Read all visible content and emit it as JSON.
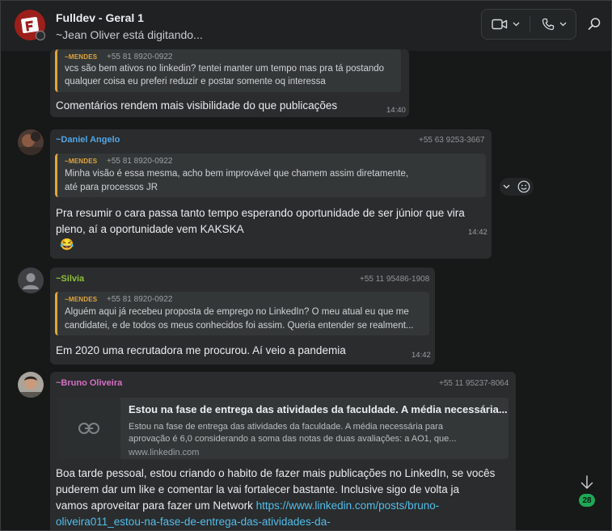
{
  "header": {
    "title": "Fulldev - Geral 1",
    "subtitle": "~Jean Oliver está digitando..."
  },
  "messages": [
    {
      "quote": {
        "name": "~MENDES",
        "phone": "+55 81 8920-0922",
        "lines": [
          "vcs são bem ativos no linkedin? tentei manter um tempo mas pra tá postando",
          "qualquer coisa eu preferi reduzir e postar somente oq interessa"
        ]
      },
      "text": [
        "Comentários rendem mais visibilidade do que publicações"
      ],
      "time": "14:40"
    },
    {
      "sender": "~Daniel Angelo",
      "sender_color": "#53a6e6",
      "phone": "+55 63 9253-3667",
      "quote": {
        "name": "~MENDES",
        "phone": "+55 81 8920-0922",
        "lines": [
          "Minha visão é essa mesma, acho bem improvável que chamem assim diretamente,",
          "até para processos JR"
        ]
      },
      "text": [
        "Pra resumir o cara passa tanto tempo esperando oportunidade de ser júnior que vira",
        "pleno, aí a oportunidade vem KAKSKA"
      ],
      "emoji": "😂",
      "time": "14:42"
    },
    {
      "sender": "~Silvia",
      "sender_color": "#8fbf3a",
      "phone": "+55 11 95486-1908",
      "quote": {
        "name": "~MENDES",
        "phone": "+55 81 8920-0922",
        "lines": [
          "Alguém aqui já recebeu proposta de emprego no LinkedIn? O meu atual eu que me",
          "candidatei, e de todos os meus conhecidos foi assim. Queria entender se realment..."
        ]
      },
      "text": [
        "Em 2020 uma recrutadora  me procurou. Aí veio a pandemia"
      ],
      "time": "14:42"
    },
    {
      "sender": "~Bruno Oliveira",
      "sender_color": "#d66fc6",
      "phone": "+55 11 95237-8064",
      "link_card": {
        "title": "Estou na fase de entrega das atividades da faculdade. A média necessária...",
        "desc": [
          "Estou na fase de entrega das atividades da faculdade. A média necessária para",
          "aprovação é 6,0 considerando a soma das notas de duas avaliações: a AO1, que..."
        ],
        "domain": "www.linkedin.com"
      },
      "text": [
        "Boa tarde pessoal, estou criando o habito de fazer mais publicações no LinkedIn, se vocês",
        "puderem dar um like e comentar la vai fortalecer bastante. Inclusive sigo de volta ja"
      ],
      "text_prefix": "vamos aproveitar para fazer um Network  ",
      "link_1": "https://www.linkedin.com/posts/bruno-",
      "link_2": "oliveira011_estou-na-fase-de-entrega-das-atividades-da-"
    }
  ],
  "unread_count": "28",
  "colors": {
    "accent": "#1fa855",
    "quote_bar": "#e0a63b",
    "link": "#53bdeb"
  },
  "icons": [
    "group-avatar-icon",
    "video-call-icon",
    "voice-call-icon",
    "search-icon",
    "link-icon",
    "emoji-icon",
    "arrow-down-icon"
  ]
}
